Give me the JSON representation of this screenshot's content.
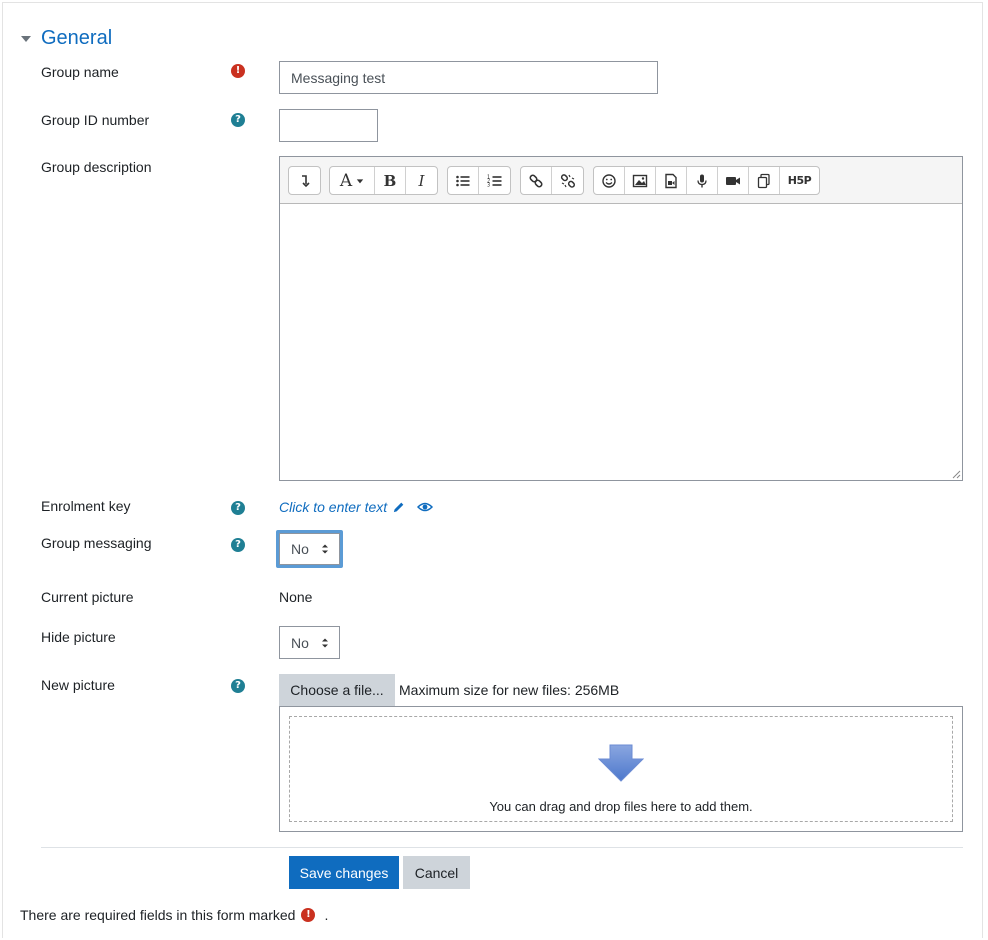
{
  "section": {
    "title": "General"
  },
  "fields": {
    "group_name": {
      "label": "Group name",
      "value": "Messaging test"
    },
    "group_id": {
      "label": "Group ID number",
      "value": ""
    },
    "group_description": {
      "label": "Group description"
    },
    "enrolment_key": {
      "label": "Enrolment key",
      "link_text": "Click to enter text"
    },
    "group_messaging": {
      "label": "Group messaging",
      "selected": "No"
    },
    "current_picture": {
      "label": "Current picture",
      "value": "None"
    },
    "hide_picture": {
      "label": "Hide picture",
      "selected": "No"
    },
    "new_picture": {
      "label": "New picture",
      "choose_label": "Choose a file...",
      "max_size": "Maximum size for new files: 256MB",
      "drop_hint": "You can drag and drop files here to add them."
    }
  },
  "editor_toolbar": {
    "icons": [
      "collapse-icon",
      "paragraph-styles-icon",
      "bold-icon",
      "italic-icon",
      "unordered-list-icon",
      "ordered-list-icon",
      "link-icon",
      "unlink-icon",
      "emoji-icon",
      "image-icon",
      "media-icon",
      "record-audio-icon",
      "record-video-icon",
      "manage-files-icon",
      "h5p-icon"
    ],
    "paragraph_glyph": "A",
    "bold_glyph": "B",
    "italic_glyph": "I",
    "h5p_glyph": "H5P"
  },
  "actions": {
    "save_label": "Save changes",
    "cancel_label": "Cancel"
  },
  "footer": {
    "required_note": "There are required fields in this form marked",
    "required_note_suffix": "."
  },
  "colors": {
    "accent": "#0f6cbf",
    "required": "#ca3120",
    "help": "#1f7f94",
    "focus": "#5b9bd5"
  }
}
